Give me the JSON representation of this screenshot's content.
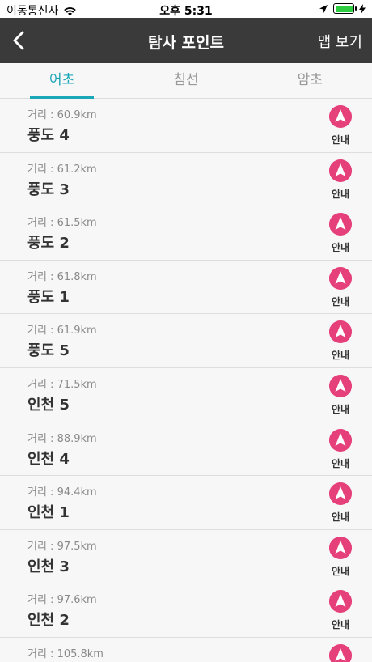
{
  "status_bar": {
    "carrier": "이동통신사",
    "time": "오후 5:31"
  },
  "nav": {
    "title": "탐사 포인트",
    "map_button": "맵 보기"
  },
  "tabs": [
    {
      "label": "어초",
      "active": true
    },
    {
      "label": "침선",
      "active": false
    },
    {
      "label": "암초",
      "active": false
    }
  ],
  "colors": {
    "accent": "#1ba7b8",
    "guide": "#e6407a",
    "navbar": "#3a3a3a"
  },
  "guide_label": "안내",
  "points": [
    {
      "distance": "거리 : 60.9km",
      "name": "풍도 4"
    },
    {
      "distance": "거리 : 61.2km",
      "name": "풍도 3"
    },
    {
      "distance": "거리 : 61.5km",
      "name": "풍도 2"
    },
    {
      "distance": "거리 : 61.8km",
      "name": "풍도 1"
    },
    {
      "distance": "거리 : 61.9km",
      "name": "풍도 5"
    },
    {
      "distance": "거리 : 71.5km",
      "name": "인천 5"
    },
    {
      "distance": "거리 : 88.9km",
      "name": "인천 4"
    },
    {
      "distance": "거리 : 94.4km",
      "name": "인천 1"
    },
    {
      "distance": "거리 : 97.5km",
      "name": "인천 3"
    },
    {
      "distance": "거리 : 97.6km",
      "name": "인천 2"
    },
    {
      "distance": "거리 : 105.8km",
      "name": ""
    }
  ]
}
